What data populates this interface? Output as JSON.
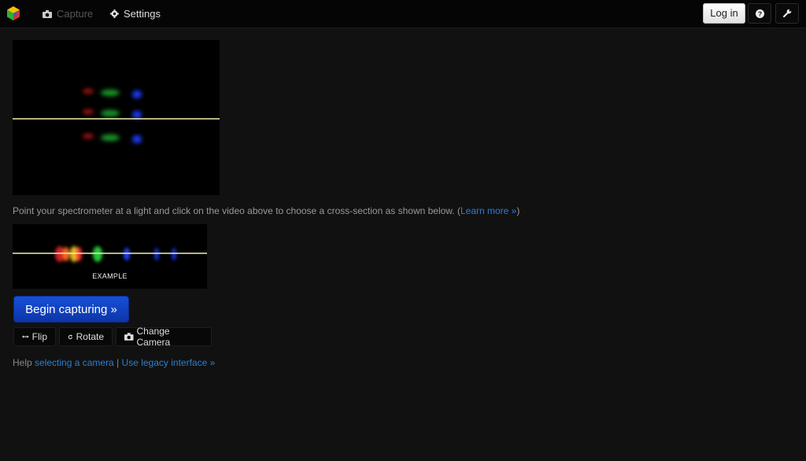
{
  "nav": {
    "capture_label": "Capture",
    "settings_label": "Settings",
    "login_label": "Log in",
    "help_icon": "question-icon",
    "tools_icon": "wrench-icon"
  },
  "instructions": {
    "text": "Point your spectrometer at a light and click on the video above to choose a cross-section as shown below. (",
    "link": "Learn more »",
    "suffix": ")"
  },
  "example": {
    "label": "EXAMPLE"
  },
  "buttons": {
    "begin": "Begin capturing »",
    "flip": "Flip",
    "rotate": "Rotate",
    "change_camera": "Change Camera"
  },
  "help": {
    "prefix": "Help ",
    "camera_link": "selecting a camera",
    "separator": " | ",
    "legacy_link": "Use legacy interface »"
  },
  "colors": {
    "accent": "#1650d8",
    "link": "#2a7fd4",
    "background": "#111111"
  }
}
